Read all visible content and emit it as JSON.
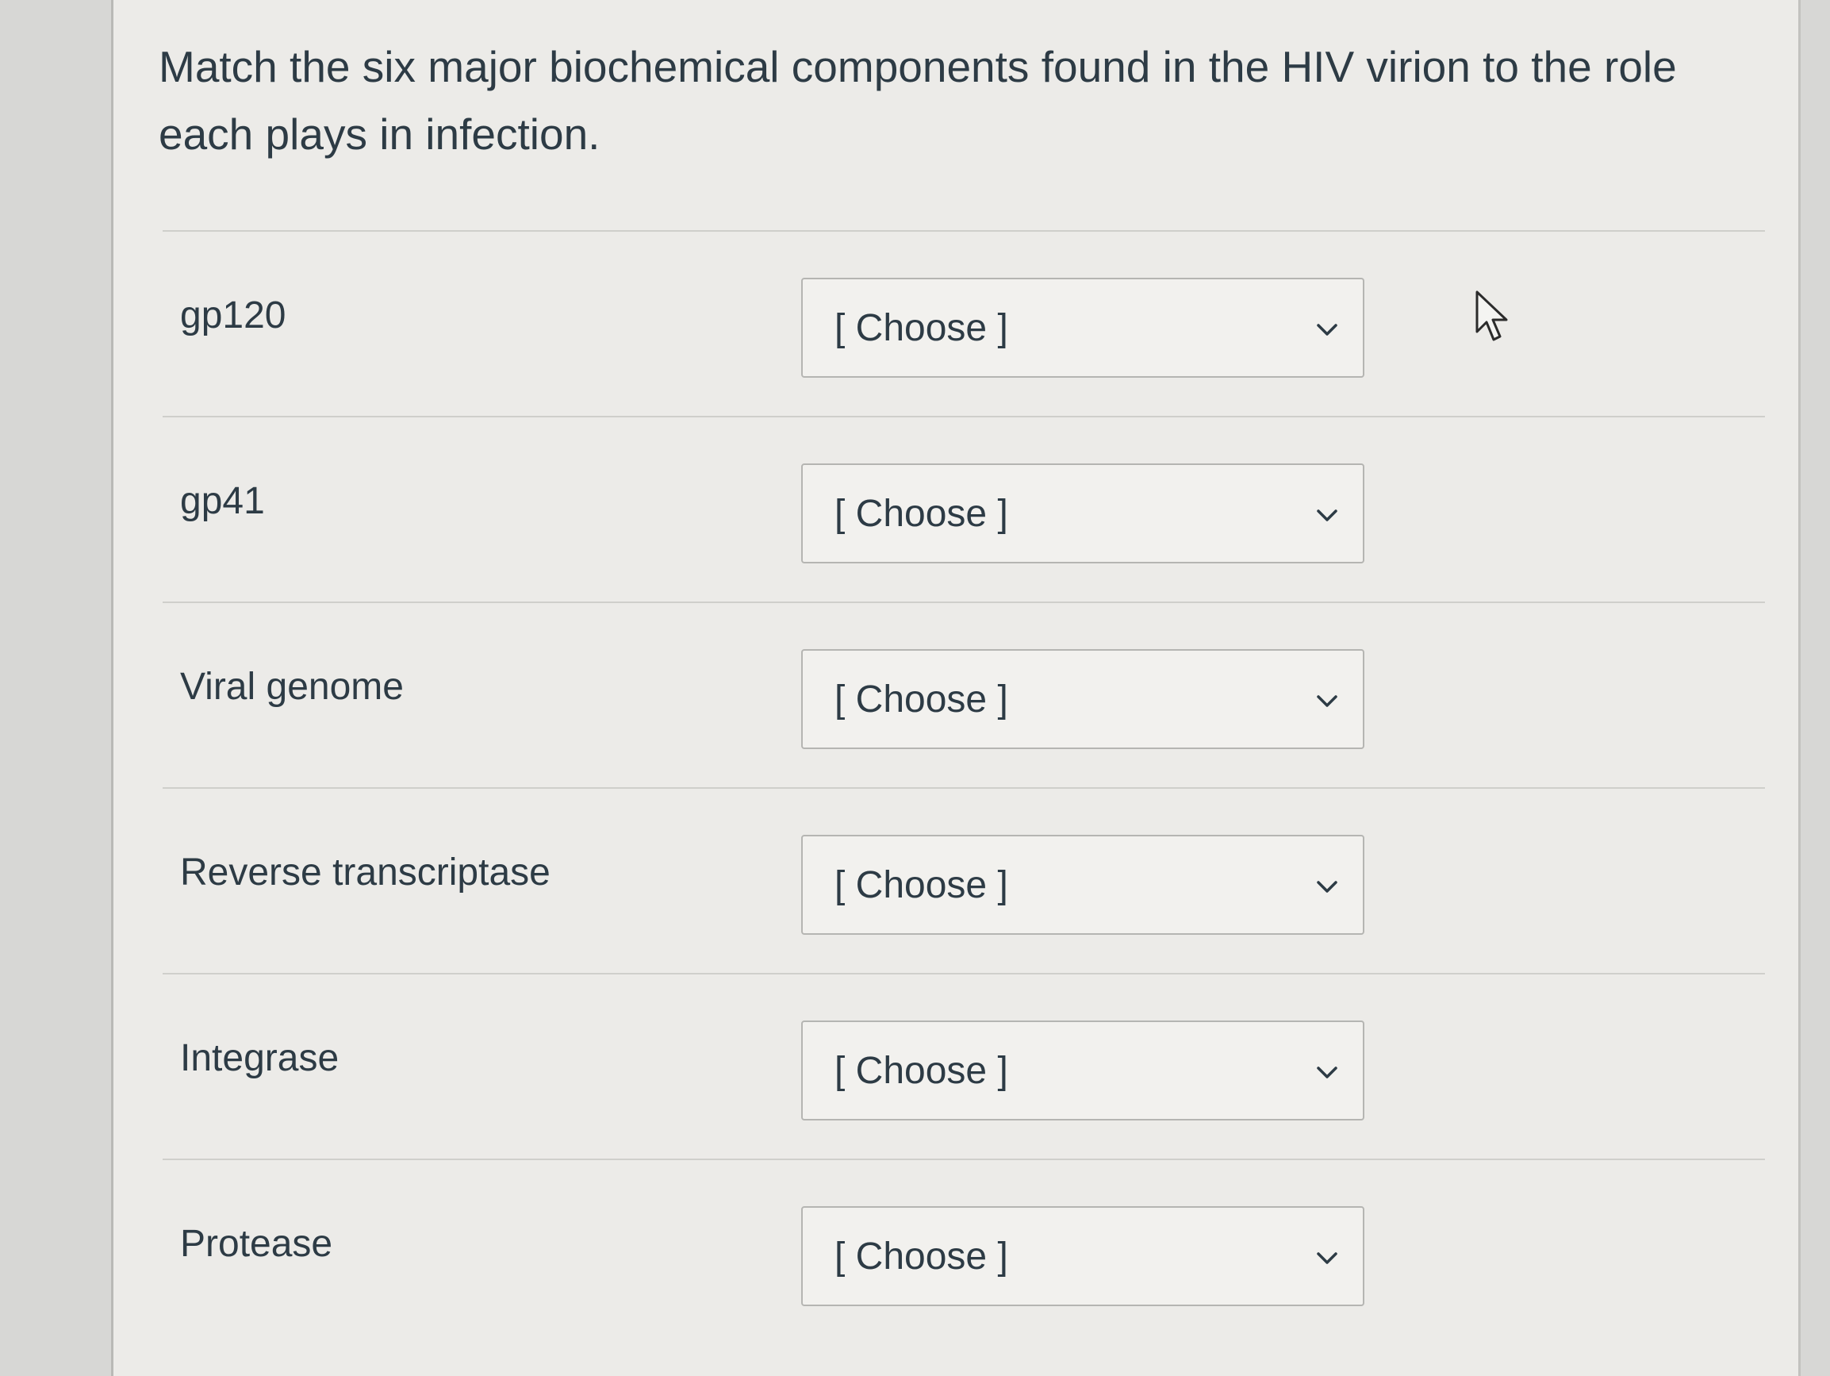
{
  "question": {
    "text": "Match the six major biochemical components found in the HIV virion to the role each plays in infection."
  },
  "rows": [
    {
      "label": "gp120",
      "select_value": "[ Choose ]"
    },
    {
      "label": "gp41",
      "select_value": "[ Choose ]"
    },
    {
      "label": "Viral genome",
      "select_value": "[ Choose ]"
    },
    {
      "label": "Reverse transcriptase",
      "select_value": "[ Choose ]"
    },
    {
      "label": "Integrase",
      "select_value": "[ Choose ]"
    },
    {
      "label": "Protease",
      "select_value": "[ Choose ]"
    }
  ],
  "icons": {
    "dropdown": "chevron-down-icon",
    "pointer": "mouse-cursor-icon"
  }
}
